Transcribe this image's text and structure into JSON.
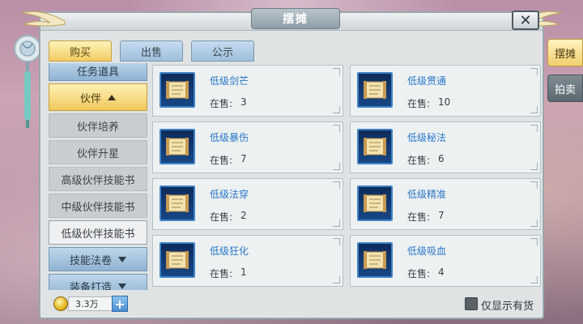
{
  "window": {
    "title": "摆摊",
    "close_label": "✕"
  },
  "tabs": [
    {
      "label": "购买",
      "active": true
    },
    {
      "label": "出售",
      "active": false
    },
    {
      "label": "公示",
      "active": false
    }
  ],
  "categories": [
    {
      "label": "任务道具",
      "style": "blue"
    },
    {
      "label": "伙伴",
      "style": "gold",
      "expanded": true
    },
    {
      "label": "伙伴培养",
      "style": "sub"
    },
    {
      "label": "伙伴升星",
      "style": "sub"
    },
    {
      "label": "高级伙伴技能书",
      "style": "sub"
    },
    {
      "label": "中级伙伴技能书",
      "style": "sub"
    },
    {
      "label": "低级伙伴技能书",
      "style": "sub",
      "selected": true
    },
    {
      "label": "技能法卷",
      "style": "blue"
    },
    {
      "label": "装备打造",
      "style": "blue"
    }
  ],
  "stock_label": "在售:",
  "items": [
    {
      "name": "低级剑芒",
      "stock": "3",
      "icon": "scroll-icon"
    },
    {
      "name": "低级贯通",
      "stock": "10",
      "icon": "scroll-icon"
    },
    {
      "name": "低级暴伤",
      "stock": "7",
      "icon": "scroll-icon"
    },
    {
      "name": "低级秘法",
      "stock": "6",
      "icon": "scroll-icon"
    },
    {
      "name": "低级法穿",
      "stock": "2",
      "icon": "scroll-icon"
    },
    {
      "name": "低级精准",
      "stock": "7",
      "icon": "scroll-icon"
    },
    {
      "name": "低级狂化",
      "stock": "1",
      "icon": "scroll-icon"
    },
    {
      "name": "低级吸血",
      "stock": "4",
      "icon": "scroll-icon"
    }
  ],
  "footer": {
    "money": "3.3万",
    "add_label": "+",
    "only_in_stock_label": "仅显示有货"
  },
  "side_tabs": [
    {
      "label": "摆摊",
      "active": true
    },
    {
      "label": "拍卖",
      "active": false
    }
  ],
  "colors": {
    "accent_gold": "#f0c95c",
    "accent_blue": "#8fb3d3",
    "item_name": "#2a78c8"
  }
}
